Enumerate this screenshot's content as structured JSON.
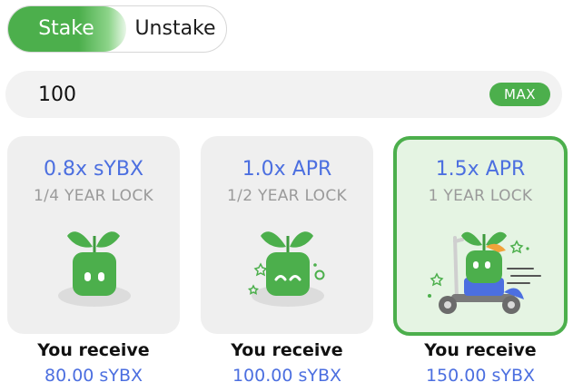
{
  "toggle": {
    "stake_label": "Stake",
    "unstake_label": "Unstake",
    "active": "Stake"
  },
  "amount": {
    "value": "100",
    "max_label": "MAX"
  },
  "options": [
    {
      "title": "0.8x sYBX",
      "lock": "1/4 YEAR LOCK",
      "receive_label": "You receive",
      "receive_value": "80.00 sYBX",
      "selected": false,
      "icon": "sprout-mascot-icon"
    },
    {
      "title": "1.0x APR",
      "lock": "1/2 YEAR LOCK",
      "receive_label": "You receive",
      "receive_value": "100.00 sYBX",
      "selected": false,
      "icon": "sprout-mascot-sparkles-icon"
    },
    {
      "title": "1.5x APR",
      "lock": "1 YEAR LOCK",
      "receive_label": "You receive",
      "receive_value": "150.00 sYBX",
      "selected": true,
      "icon": "sprout-mascot-scooter-icon"
    }
  ],
  "colors": {
    "accent_green": "#4caf4c",
    "value_blue": "#4c6fe0",
    "muted_gray": "#9a9a9a",
    "selected_bg": "#e5f4e3"
  }
}
